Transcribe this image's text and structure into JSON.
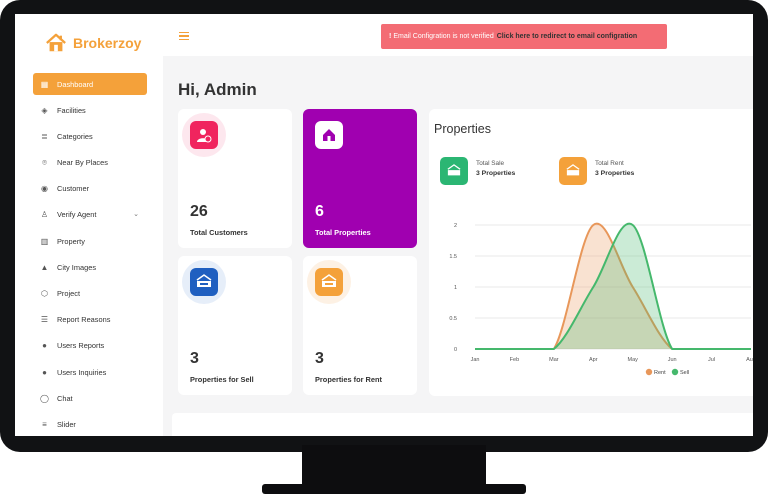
{
  "brand": {
    "name": "Brokerzoy",
    "color": "#f4a13a"
  },
  "sidebar": {
    "items": [
      {
        "label": "Dashboard",
        "icon": "grid-icon",
        "active": true
      },
      {
        "label": "Facilities",
        "icon": "diamond-icon"
      },
      {
        "label": "Categories",
        "icon": "list-icon"
      },
      {
        "label": "Near By Places",
        "icon": "location-icon"
      },
      {
        "label": "Customer",
        "icon": "user-circle-icon"
      },
      {
        "label": "Verify Agent",
        "icon": "user-check-icon",
        "expandable": true
      },
      {
        "label": "Property",
        "icon": "bar-chart-icon"
      },
      {
        "label": "City Images",
        "icon": "image-icon"
      },
      {
        "label": "Project",
        "icon": "cube-icon"
      },
      {
        "label": "Report Reasons",
        "icon": "list-ordered-icon"
      },
      {
        "label": "Users Reports",
        "icon": "alert-circle-icon"
      },
      {
        "label": "Users Inquiries",
        "icon": "question-circle-icon"
      },
      {
        "label": "Chat",
        "icon": "chat-icon"
      },
      {
        "label": "Slider",
        "icon": "sliders-icon"
      }
    ]
  },
  "alert": {
    "message": "Email Configration is not verified",
    "link": "Click here to redirect to email configration",
    "color": "#f36c74"
  },
  "greeting": "Hi, Admin",
  "cards": [
    {
      "value": "26",
      "label": "Total Customers",
      "icon": "user-check-icon",
      "color": "#f0245e"
    },
    {
      "value": "6",
      "label": "Total Properties",
      "icon": "house-icon",
      "color": "#a000b0"
    },
    {
      "value": "3",
      "label": "Properties for Sell",
      "icon": "sale-sign-icon",
      "color": "#1f5fc0"
    },
    {
      "value": "3",
      "label": "Properties for Rent",
      "icon": "rent-sign-icon",
      "color": "#f4a13a"
    }
  ],
  "properties_panel": {
    "title": "Properties",
    "total_sale": {
      "label": "Total Sale",
      "value": "3 Properties",
      "color": "#2bb673"
    },
    "total_rent": {
      "label": "Total Rent",
      "value": "3 Properties",
      "color": "#f4a13a"
    }
  },
  "chart_data": {
    "type": "area",
    "categories": [
      "Jan",
      "Feb",
      "Mar",
      "Apr",
      "May",
      "Jun",
      "Jul",
      "Aug"
    ],
    "yticks": [
      "0",
      "0.5",
      "1",
      "1.5",
      "2"
    ],
    "ylim": [
      0,
      2
    ],
    "series": [
      {
        "name": "Rent",
        "color": "#e8975a",
        "values": [
          0,
          0,
          0,
          2,
          1,
          0,
          0,
          0
        ]
      },
      {
        "name": "Sell",
        "color": "#45b86c",
        "values": [
          0,
          0,
          0,
          1,
          2,
          0,
          0,
          0
        ]
      }
    ],
    "legend": "bottom",
    "grid": true
  }
}
